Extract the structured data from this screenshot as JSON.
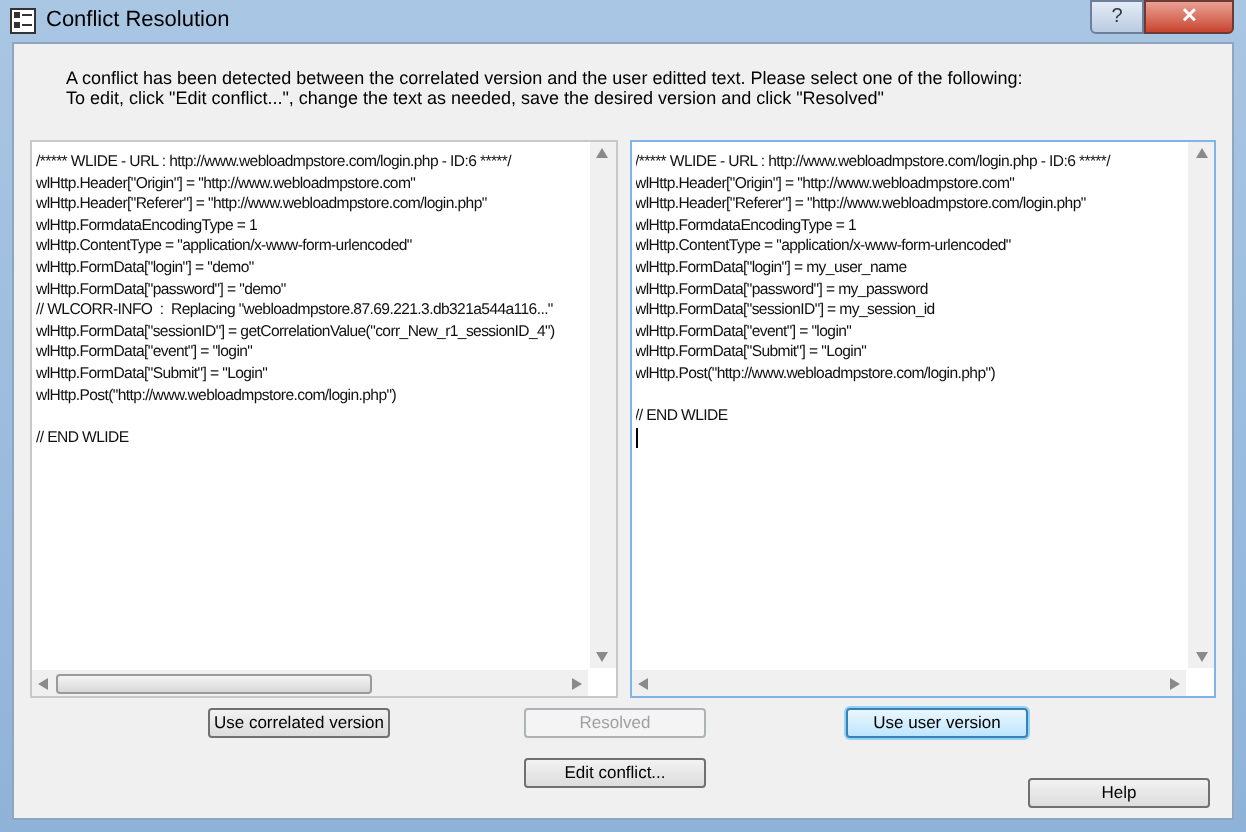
{
  "window": {
    "title": "Conflict Resolution",
    "buttons": [
      "?",
      "✕"
    ]
  },
  "instructions": [
    "A conflict has been detected between the correlated version and the user editted text. Please select one of the following:",
    "To edit, click \"Edit conflict...\", change the text as needed, save the desired version and click \"Resolved\""
  ],
  "panels": [
    {
      "focused": false,
      "has_horizontal_thumb": true,
      "lines": [
        "/***** WLIDE - URL : http://www.webloadmpstore.com/login.php - ID:6 *****/",
        "wlHttp.Header[\"Origin\"] = \"http://www.webloadmpstore.com\"",
        "wlHttp.Header[\"Referer\"] = \"http://www.webloadmpstore.com/login.php\"",
        "wlHttp.FormdataEncodingType = 1",
        "wlHttp.ContentType = \"application/x-www-form-urlencoded\"",
        "wlHttp.FormData[\"login\"] = \"demo\"",
        "wlHttp.FormData[\"password\"] = \"demo\"",
        "// WLCORR-INFO  :  Replacing \"webloadmpstore.87.69.221.3.db321a544a116...\"",
        "wlHttp.FormData[\"sessionID\"] = getCorrelationValue(\"corr_New_r1_sessionID_4\")",
        "wlHttp.FormData[\"event\"] = \"login\"",
        "wlHttp.FormData[\"Submit\"] = \"Login\"",
        "wlHttp.Post(\"http://www.webloadmpstore.com/login.php\")"
      ],
      "end_comment": "// END WLIDE"
    },
    {
      "focused": true,
      "has_horizontal_thumb": false,
      "lines": [
        "/***** WLIDE - URL : http://www.webloadmpstore.com/login.php - ID:6 *****/",
        "wlHttp.Header[\"Origin\"] = \"http://www.webloadmpstore.com\"",
        "wlHttp.Header[\"Referer\"] = \"http://www.webloadmpstore.com/login.php\"",
        "wlHttp.FormdataEncodingType = 1",
        "wlHttp.ContentType = \"application/x-www-form-urlencoded\"",
        "wlHttp.FormData[\"login\"] = my_user_name",
        "wlHttp.FormData[\"password\"] = my_password",
        "wlHttp.FormData[\"sessionID\"] = my_session_id",
        "wlHttp.FormData[\"event\"] = \"login\"",
        "wlHttp.FormData[\"Submit\"] = \"Login\"",
        "wlHttp.Post(\"http://www.webloadmpstore.com/login.php\")"
      ],
      "end_comment": "// END WLIDE"
    }
  ],
  "row_buttons": [
    {
      "label": "Use correlated version",
      "disabled": false,
      "default": false
    },
    {
      "label": "Resolved",
      "disabled": true,
      "default": false
    },
    {
      "label": "Use user version",
      "disabled": false,
      "default": true
    }
  ],
  "edit_button": {
    "label": "Edit conflict..."
  },
  "help_button": {
    "label": "Help"
  }
}
